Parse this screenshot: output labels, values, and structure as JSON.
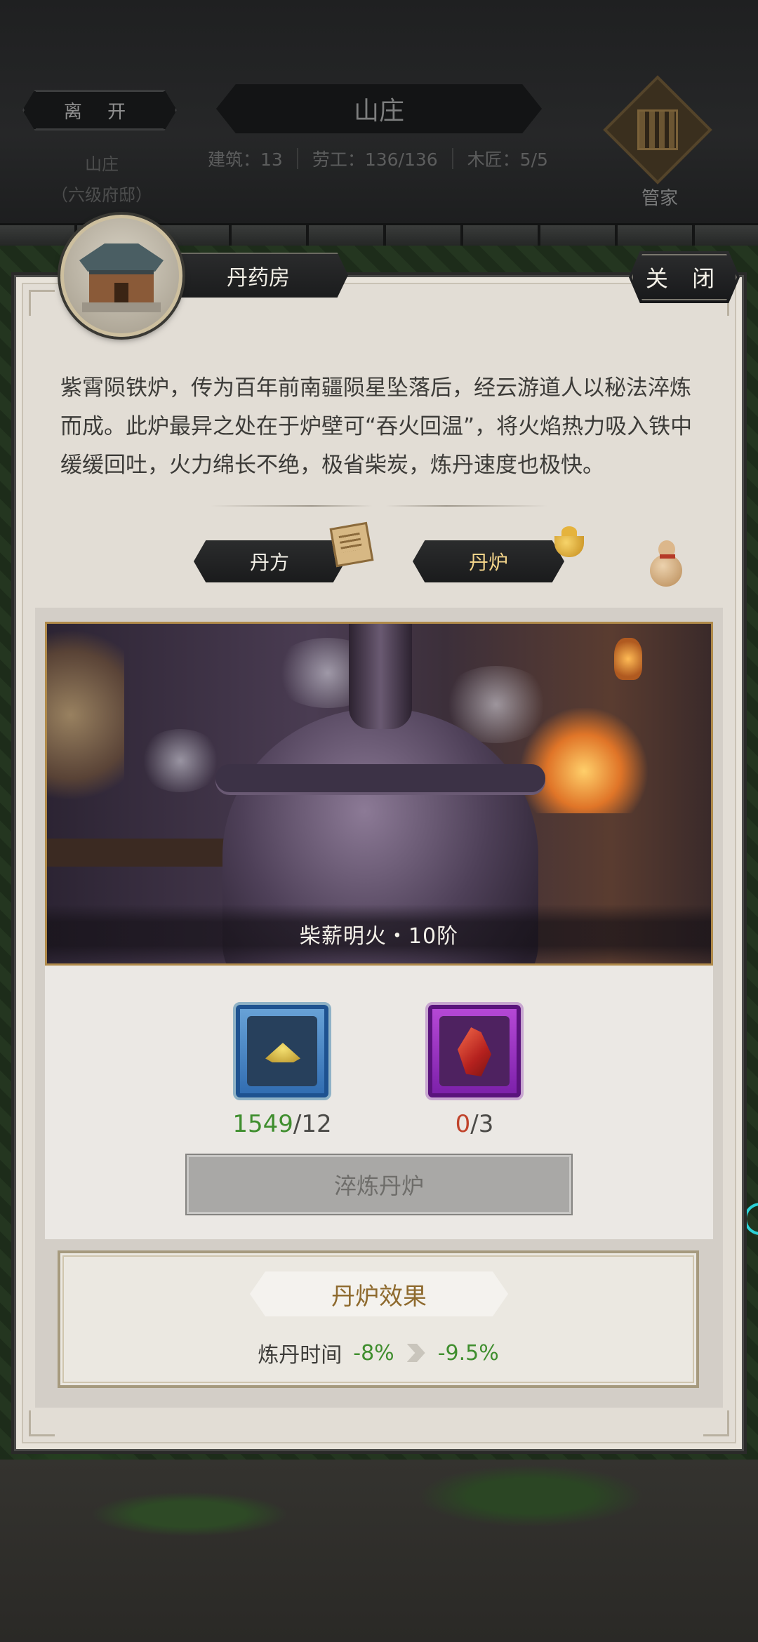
{
  "header": {
    "leave_label": "离 开",
    "estate_name": "山庄",
    "estate_rank": "（六级府邸）",
    "title": "山庄",
    "stats": [
      "建筑：13",
      "劳工：136/136",
      "木匠：5/5"
    ],
    "manager_label": "管家"
  },
  "panel": {
    "room_name": "丹药房",
    "close_label": "关 闭",
    "description": "紫霄陨铁炉，传为百年前南疆陨星坠落后，经云游道人以秘法淬炼而成。此炉最异之处在于炉壁可“吞火回温”，将火焰热力吸入铁中缓缓回吐，火力绵长不绝，极省柴炭，炼丹速度也极快。",
    "tabs": [
      {
        "label": "丹方",
        "active": false
      },
      {
        "label": "丹炉",
        "active": true
      }
    ],
    "furnace_caption": "柴薪明火・10阶",
    "materials": [
      {
        "icon": "gold-powder-icon",
        "have": "1549",
        "need": "/12",
        "enough": true
      },
      {
        "icon": "red-crystal-icon",
        "have": "0",
        "need": "/3",
        "enough": false
      }
    ],
    "temper_button": "淬炼丹炉",
    "effect": {
      "title": "丹炉效果",
      "label": "炼丹时间",
      "current": "-8%",
      "next": "-9.5%"
    }
  },
  "colors": {
    "accent_green": "#3f8e2e",
    "accent_red": "#c0432b",
    "gold_text": "#8e6a2e"
  }
}
